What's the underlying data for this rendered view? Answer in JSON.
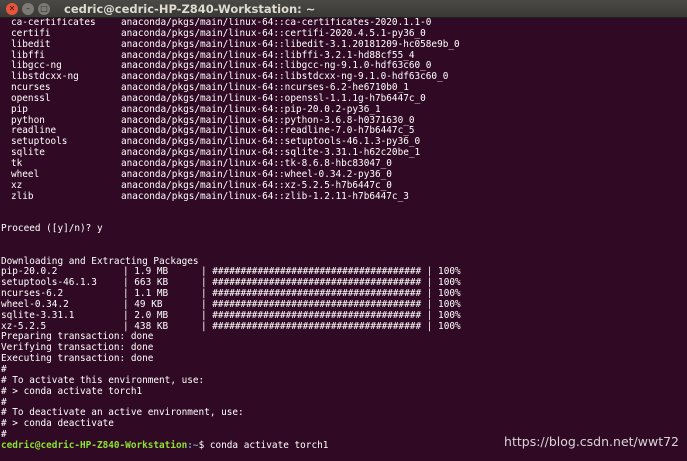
{
  "window": {
    "title": "cedric@cedric-HP-Z840-Workstation: ~"
  },
  "packages": [
    {
      "name": "ca-certificates",
      "source": "anaconda/pkgs/main/linux-64::ca-certificates-2020.1.1-0"
    },
    {
      "name": "certifi",
      "source": "anaconda/pkgs/main/linux-64::certifi-2020.4.5.1-py36_0"
    },
    {
      "name": "libedit",
      "source": "anaconda/pkgs/main/linux-64::libedit-3.1.20181209-hc058e9b_0"
    },
    {
      "name": "libffi",
      "source": "anaconda/pkgs/main/linux-64::libffi-3.2.1-hd88cf55_4"
    },
    {
      "name": "libgcc-ng",
      "source": "anaconda/pkgs/main/linux-64::libgcc-ng-9.1.0-hdf63c60_0"
    },
    {
      "name": "libstdcxx-ng",
      "source": "anaconda/pkgs/main/linux-64::libstdcxx-ng-9.1.0-hdf63c60_0"
    },
    {
      "name": "ncurses",
      "source": "anaconda/pkgs/main/linux-64::ncurses-6.2-he6710b0_1"
    },
    {
      "name": "openssl",
      "source": "anaconda/pkgs/main/linux-64::openssl-1.1.1g-h7b6447c_0"
    },
    {
      "name": "pip",
      "source": "anaconda/pkgs/main/linux-64::pip-20.0.2-py36_1"
    },
    {
      "name": "python",
      "source": "anaconda/pkgs/main/linux-64::python-3.6.8-h0371630_0"
    },
    {
      "name": "readline",
      "source": "anaconda/pkgs/main/linux-64::readline-7.0-h7b6447c_5"
    },
    {
      "name": "setuptools",
      "source": "anaconda/pkgs/main/linux-64::setuptools-46.1.3-py36_0"
    },
    {
      "name": "sqlite",
      "source": "anaconda/pkgs/main/linux-64::sqlite-3.31.1-h62c20be_1"
    },
    {
      "name": "tk",
      "source": "anaconda/pkgs/main/linux-64::tk-8.6.8-hbc83047_0"
    },
    {
      "name": "wheel",
      "source": "anaconda/pkgs/main/linux-64::wheel-0.34.2-py36_0"
    },
    {
      "name": "xz",
      "source": "anaconda/pkgs/main/linux-64::xz-5.2.5-h7b6447c_0"
    },
    {
      "name": "zlib",
      "source": "anaconda/pkgs/main/linux-64::zlib-1.2.11-h7b6447c_3"
    }
  ],
  "proceed_line": "Proceed ([y]/n)? y",
  "downloading_header": "Downloading and Extracting Packages",
  "downloads": [
    {
      "name": "pip-20.0.2",
      "size": "| 1.9 MB",
      "progress": "| ##################################### | 100%"
    },
    {
      "name": "setuptools-46.1.3",
      "size": "| 663 KB",
      "progress": "| ##################################### | 100%"
    },
    {
      "name": "ncurses-6.2",
      "size": "| 1.1 MB",
      "progress": "| ##################################### | 100%"
    },
    {
      "name": "wheel-0.34.2",
      "size": "| 49 KB",
      "progress": "| ##################################### | 100%"
    },
    {
      "name": "sqlite-3.31.1",
      "size": "| 2.0 MB",
      "progress": "| ##################################### | 100%"
    },
    {
      "name": "xz-5.2.5",
      "size": "| 438 KB",
      "progress": "| ##################################### | 100%"
    }
  ],
  "transaction": [
    "Preparing transaction: done",
    "Verifying transaction: done",
    "Executing transaction: done"
  ],
  "notes": [
    "#",
    "# To activate this environment, use:",
    "# > conda activate torch1",
    "#",
    "# To deactivate an active environment, use:",
    "# > conda deactivate",
    "#"
  ],
  "prompt": {
    "user_host": "cedric@cedric-HP-Z840-Workstation",
    "path": ":~",
    "command": "$ conda activate torch1"
  },
  "watermark": "https://blog.csdn.net/wwt72"
}
